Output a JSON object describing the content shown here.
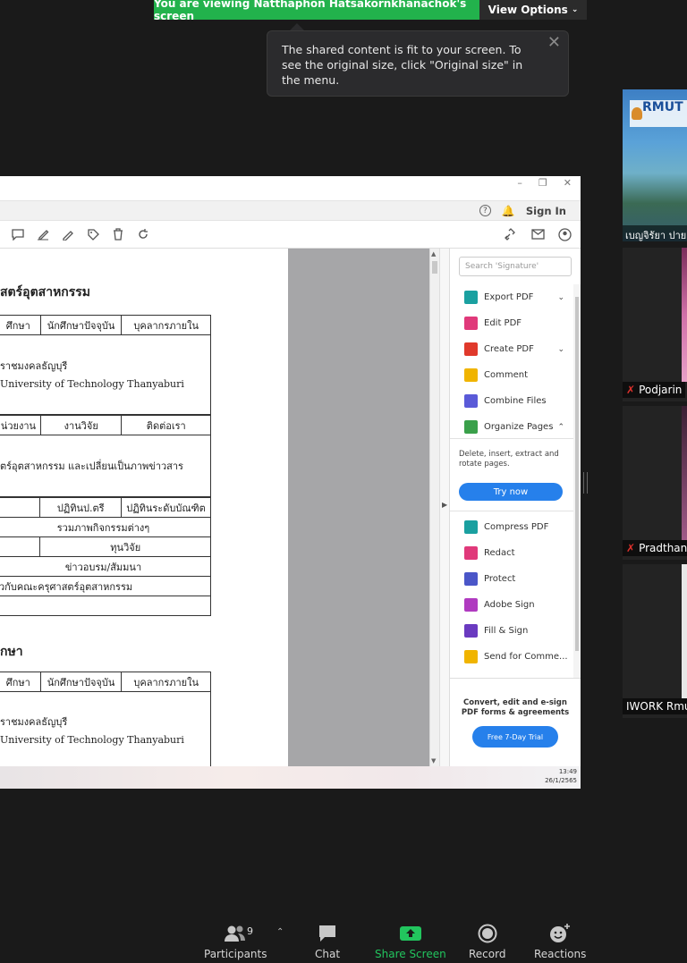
{
  "banner": {
    "viewing": "You are viewing Natthaphon Hatsakornkhanachok's screen",
    "view_options": "View Options"
  },
  "tooltip": {
    "text": "The shared content is fit to your screen. To see the original size, click \"Original size\" in the menu."
  },
  "acrobat": {
    "sign_in": "Sign In",
    "search_placeholder": "Search 'Signature'",
    "tools_top": [
      {
        "label": "Export PDF",
        "color": "#1aa0a0",
        "chevron": "down"
      },
      {
        "label": "Edit PDF",
        "color": "#e0397a",
        "chevron": ""
      },
      {
        "label": "Create PDF",
        "color": "#e0392b",
        "chevron": "down"
      },
      {
        "label": "Comment",
        "color": "#f0b400",
        "chevron": ""
      },
      {
        "label": "Combine Files",
        "color": "#5a5ad8",
        "chevron": ""
      },
      {
        "label": "Organize Pages",
        "color": "#3aa04a",
        "chevron": "up"
      }
    ],
    "organize_desc": "Delete, insert, extract and rotate pages.",
    "try_now": "Try now",
    "tools_bottom": [
      {
        "label": "Compress PDF",
        "color": "#1aa0a0"
      },
      {
        "label": "Redact",
        "color": "#e0397a"
      },
      {
        "label": "Protect",
        "color": "#4a56c8"
      },
      {
        "label": "Adobe Sign",
        "color": "#b03ac0"
      },
      {
        "label": "Fill & Sign",
        "color": "#6a3ac0"
      },
      {
        "label": "Send for Comme...",
        "color": "#f0b400"
      }
    ],
    "promo_text": "Convert, edit and e-sign PDF forms & agreements",
    "trial": "Free 7-Day Trial"
  },
  "document": {
    "heading1": "สตร์อุตสาหกรรม",
    "row1": [
      "ศึกษา",
      "นักศึกษาปัจจุบัน",
      "บุคลากรภายใน"
    ],
    "line1": "ราชมงคลธัญบุรี",
    "line2": "University of Technology Thanyaburi",
    "row2": [
      "น่วยงาน",
      "งานวิจัย",
      "ติดต่อเรา"
    ],
    "line3": "ตร์อุตสาหกรรม และเปลี่ยนเป็นภาพข่าวสาร",
    "row3": [
      "ปฏิทินป.ตรี",
      "ปฏิทินระดับบัณฑิต"
    ],
    "row4": "รวมภาพกิจกรรมต่างๆ",
    "row5": "ทุนวิจัย",
    "row6": "ข่าวอบรม/สัมมนา",
    "row7": "วกับคณะครุศาสตร์อุตสาหกรรม",
    "heading2": "กษา",
    "row8": [
      "ศึกษา",
      "นักศึกษาปัจจุบัน",
      "บุคลากรภายใน"
    ],
    "line4": "ราชมงคลธัญบุรี",
    "line5": "University of Technology Thanyaburi"
  },
  "taskbar": {
    "time": "13:49",
    "date": "26/1/2565"
  },
  "gallery": {
    "tile1_name": "เบญจิรัยา ปาย",
    "tile1_logo": "RMUT",
    "tile2_name": "Podjarin",
    "tile3_name": "Pradthana",
    "tile4_name": "IWORK Rmu"
  },
  "bottom_bar": {
    "participants": "Participants",
    "participants_count": "9",
    "chat": "Chat",
    "share_screen": "Share Screen",
    "record": "Record",
    "reactions": "Reactions"
  }
}
